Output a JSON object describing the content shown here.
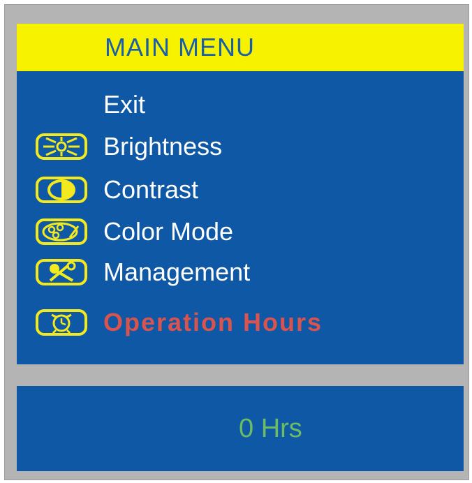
{
  "menu": {
    "title": "MAIN  MENU",
    "title_color": "#1b5ea8",
    "title_bar_color": "#f7f300",
    "panel_color": "#0e58a6",
    "items": [
      {
        "label": "Exit",
        "icon": null
      },
      {
        "label": "Brightness",
        "icon": "brightness-icon"
      },
      {
        "label": "Contrast",
        "icon": "contrast-icon"
      },
      {
        "label": "Color  Mode",
        "icon": "color-mode-icon"
      },
      {
        "label": "Management",
        "icon": "management-icon"
      },
      {
        "label": "Operation Hours",
        "icon": "operation-hours-icon",
        "selected": true
      }
    ],
    "item_color": "#ffffff",
    "selected_color": "#d9534f",
    "icon_color": "#f2ea1f"
  },
  "status": {
    "hours_value": "0  Hrs",
    "hours_color": "#6dbb63"
  }
}
